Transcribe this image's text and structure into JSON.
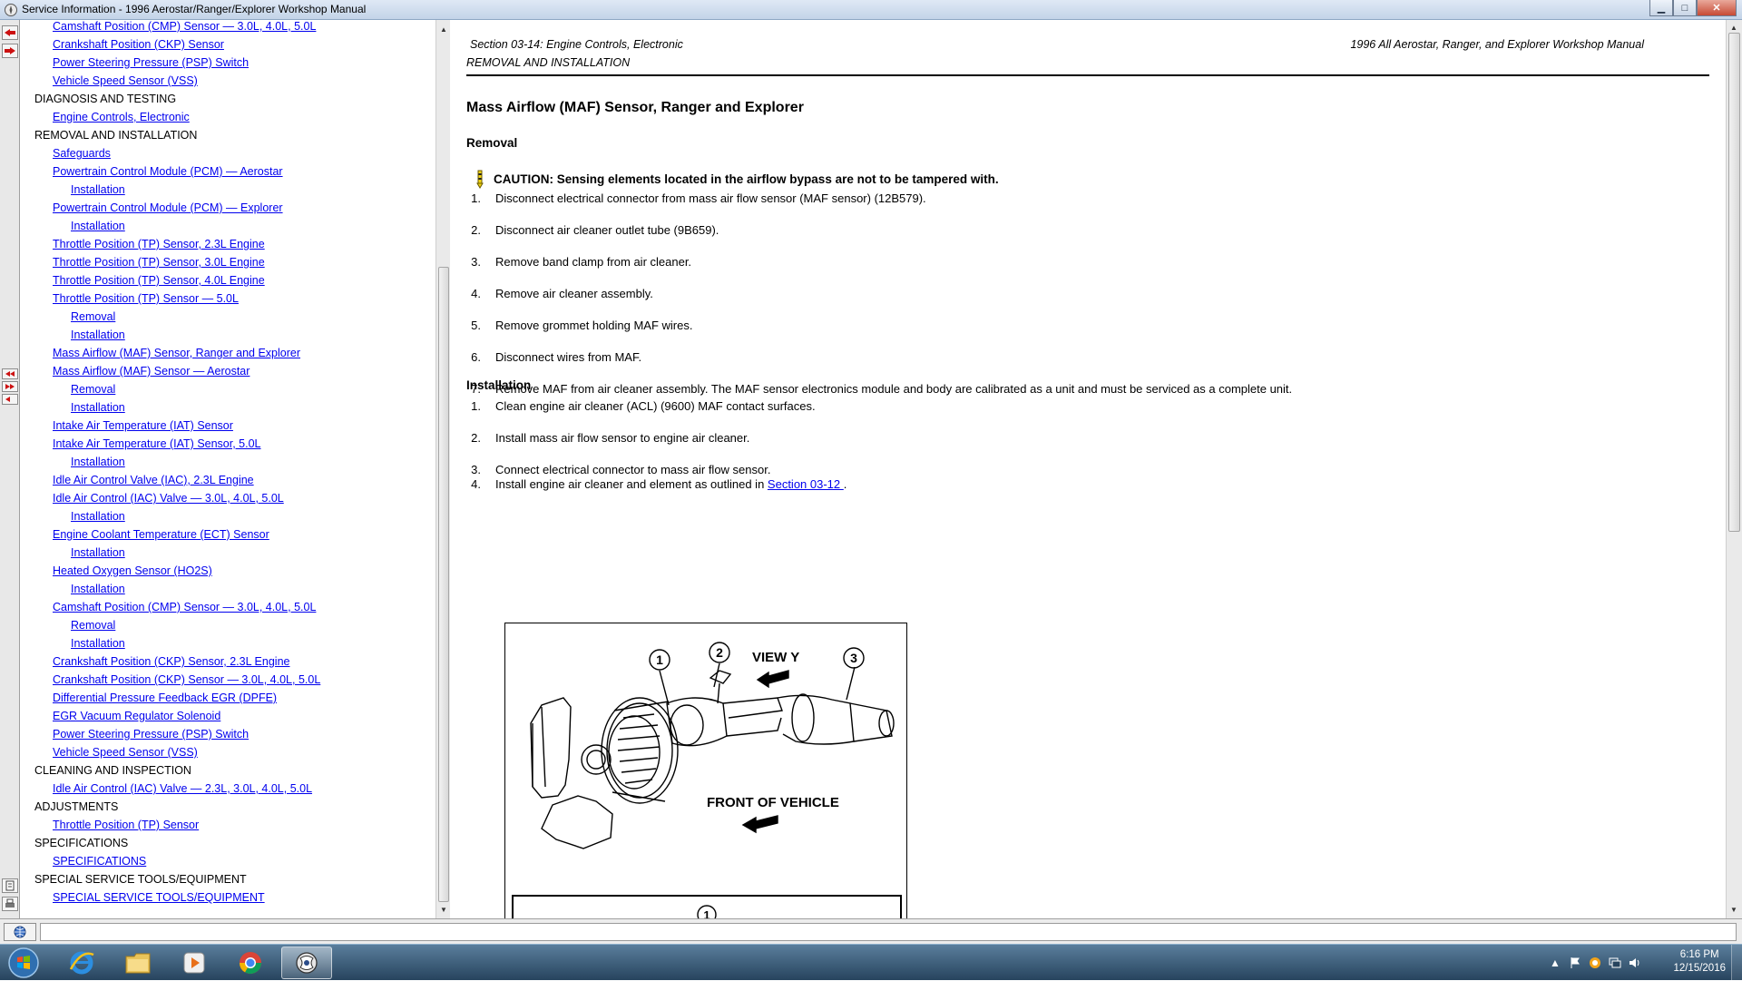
{
  "window": {
    "title": "Service Information - 1996 Aerostar/Ranger/Explorer Workshop Manual",
    "controls": {
      "minimize": "▁",
      "maximize": "□",
      "close": "✕"
    }
  },
  "toc": [
    {
      "level": 1,
      "text": "Camshaft Position (CMP) Sensor — 3.0L, 4.0L, 5.0L"
    },
    {
      "level": 1,
      "text": "Crankshaft Position (CKP) Sensor"
    },
    {
      "level": 1,
      "text": "Power Steering Pressure (PSP) Switch"
    },
    {
      "level": 1,
      "text": "Vehicle Speed Sensor (VSS)"
    },
    {
      "level": 0,
      "text": "DIAGNOSIS AND TESTING"
    },
    {
      "level": 1,
      "text": "Engine Controls, Electronic"
    },
    {
      "level": 0,
      "text": "REMOVAL AND INSTALLATION"
    },
    {
      "level": 1,
      "text": "Safeguards"
    },
    {
      "level": 1,
      "text": "Powertrain Control Module (PCM) — Aerostar"
    },
    {
      "level": 2,
      "text": "Installation"
    },
    {
      "level": 1,
      "text": "Powertrain Control Module (PCM) — Explorer"
    },
    {
      "level": 2,
      "text": "Installation"
    },
    {
      "level": 1,
      "text": "Throttle Position (TP) Sensor, 2.3L Engine"
    },
    {
      "level": 1,
      "text": "Throttle Position (TP) Sensor, 3.0L Engine"
    },
    {
      "level": 1,
      "text": "Throttle Position (TP) Sensor, 4.0L Engine"
    },
    {
      "level": 1,
      "text": "Throttle Position (TP) Sensor — 5.0L"
    },
    {
      "level": 2,
      "text": "Removal"
    },
    {
      "level": 2,
      "text": "Installation"
    },
    {
      "level": 1,
      "text": "Mass Airflow (MAF) Sensor, Ranger and Explorer"
    },
    {
      "level": 1,
      "text": "Mass Airflow (MAF) Sensor — Aerostar"
    },
    {
      "level": 2,
      "text": "Removal"
    },
    {
      "level": 2,
      "text": "Installation"
    },
    {
      "level": 1,
      "text": "Intake Air Temperature (IAT) Sensor"
    },
    {
      "level": 1,
      "text": "Intake Air Temperature (IAT) Sensor, 5.0L"
    },
    {
      "level": 2,
      "text": "Installation"
    },
    {
      "level": 1,
      "text": "Idle Air Control Valve (IAC), 2.3L Engine"
    },
    {
      "level": 1,
      "text": "Idle Air Control (IAC) Valve — 3.0L, 4.0L, 5.0L"
    },
    {
      "level": 2,
      "text": "Installation"
    },
    {
      "level": 1,
      "text": "Engine Coolant Temperature (ECT) Sensor"
    },
    {
      "level": 2,
      "text": "Installation"
    },
    {
      "level": 1,
      "text": "Heated Oxygen Sensor (HO2S)"
    },
    {
      "level": 2,
      "text": "Installation"
    },
    {
      "level": 1,
      "text": "Camshaft Position (CMP) Sensor — 3.0L, 4.0L, 5.0L"
    },
    {
      "level": 2,
      "text": "Removal"
    },
    {
      "level": 2,
      "text": "Installation"
    },
    {
      "level": 1,
      "text": "Crankshaft Position (CKP) Sensor, 2.3L Engine"
    },
    {
      "level": 1,
      "text": "Crankshaft Position (CKP) Sensor — 3.0L, 4.0L, 5.0L"
    },
    {
      "level": 1,
      "text": "Differential Pressure Feedback EGR (DPFE)"
    },
    {
      "level": 1,
      "text": "EGR Vacuum Regulator Solenoid"
    },
    {
      "level": 1,
      "text": "Power Steering Pressure (PSP) Switch"
    },
    {
      "level": 1,
      "text": "Vehicle Speed Sensor (VSS)"
    },
    {
      "level": 0,
      "text": "CLEANING AND INSPECTION"
    },
    {
      "level": 1,
      "text": "Idle Air Control (IAC) Valve — 2.3L, 3.0L, 4.0L, 5.0L"
    },
    {
      "level": 0,
      "text": "ADJUSTMENTS"
    },
    {
      "level": 1,
      "text": "Throttle Position (TP) Sensor"
    },
    {
      "level": 0,
      "text": "SPECIFICATIONS"
    },
    {
      "level": 1,
      "text": "SPECIFICATIONS"
    },
    {
      "level": 0,
      "text": "SPECIAL SERVICE TOOLS/EQUIPMENT"
    },
    {
      "level": 1,
      "text": "SPECIAL SERVICE TOOLS/EQUIPMENT"
    }
  ],
  "doc": {
    "header_section": "Section 03-14: Engine Controls, Electronic",
    "header_subsection": "REMOVAL AND INSTALLATION",
    "header_manual": "1996 All Aerostar, Ranger, and Explorer Workshop Manual",
    "title": "Mass Airflow (MAF) Sensor, Ranger and Explorer",
    "removal_heading": "Removal",
    "caution": "CAUTION: Sensing elements located in the airflow bypass are not to be tampered with.",
    "removal_steps": [
      {
        "num": "1.",
        "text": "Disconnect electrical connector from mass air flow sensor (MAF sensor) (12B579)."
      },
      {
        "num": "2.",
        "text": "Disconnect air cleaner outlet tube (9B659)."
      },
      {
        "num": "3.",
        "text": "Remove band clamp from air cleaner."
      },
      {
        "num": "4.",
        "text": "Remove air cleaner assembly."
      },
      {
        "num": "5.",
        "text": "Remove grommet holding MAF wires."
      },
      {
        "num": "6.",
        "text": "Disconnect wires from MAF."
      },
      {
        "num": "7.",
        "text": "Remove MAF from air cleaner assembly. The MAF sensor electronics module and body are calibrated as a unit and must be serviced as a complete unit."
      }
    ],
    "installation_heading": "Installation",
    "installation_steps": [
      {
        "num": "1.",
        "text": "Clean engine air cleaner (ACL) (9600) MAF contact surfaces."
      },
      {
        "num": "2.",
        "text": "Install mass air flow sensor to engine air cleaner."
      },
      {
        "num": "3.",
        "text": "Connect electrical connector to mass air flow sensor."
      }
    ],
    "install_step4_num": "4.",
    "install_step4_prefix": "Install engine air cleaner and element as outlined in ",
    "install_step4_link": "Section 03-12 ",
    "install_step4_suffix": ".",
    "figure": {
      "view_label": "VIEW Y",
      "front_label": "FRONT OF VEHICLE",
      "callouts": [
        "1",
        "2",
        "3"
      ],
      "table_callout": "1"
    }
  },
  "taskbar": {
    "apps": [
      "start",
      "internet-explorer",
      "file-explorer",
      "media-player",
      "chrome",
      "service-info"
    ],
    "clock_time": "6:16 PM",
    "clock_date": "12/15/2016"
  },
  "colors": {
    "link": "#0000ee",
    "taskbar": "#27445e",
    "titlebar": "#c3d4e8"
  }
}
